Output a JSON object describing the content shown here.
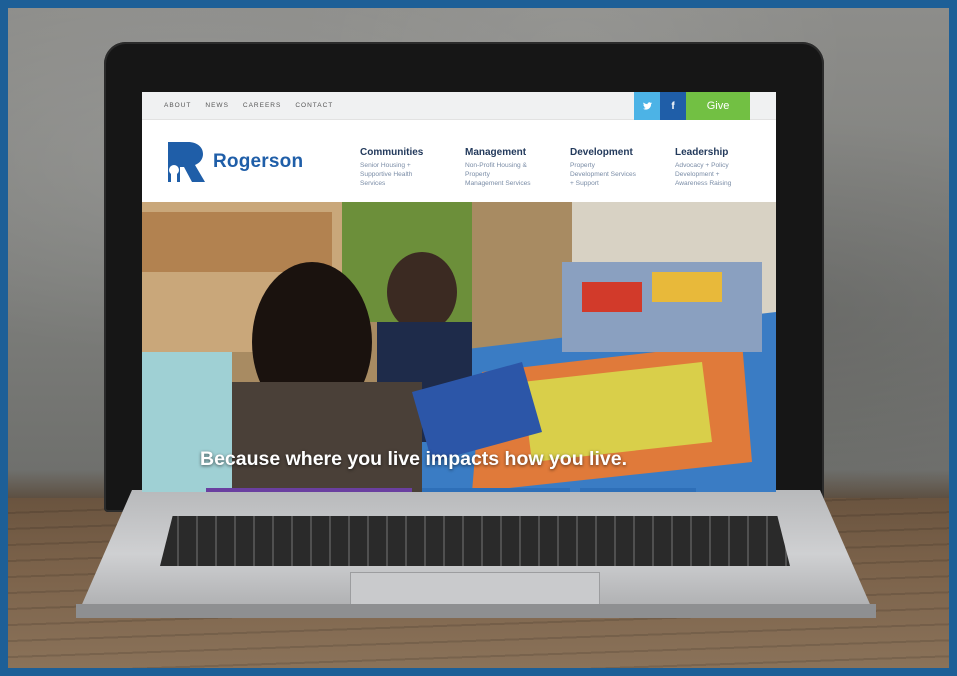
{
  "site": {
    "top_nav": [
      "ABOUT",
      "NEWS",
      "CAREERS",
      "CONTACT"
    ],
    "social": {
      "twitter": "twitter-icon",
      "facebook": "f"
    },
    "give_label": "Give",
    "brand": "Rogerson",
    "nav": [
      {
        "title": "Communities",
        "sub": [
          "Senior Housing +",
          "Supportive Health",
          "Services"
        ]
      },
      {
        "title": "Management",
        "sub": [
          "Non-Profit Housing &",
          "Property",
          "Management Services"
        ]
      },
      {
        "title": "Development",
        "sub": [
          "Property",
          "Development Services",
          "+ Support"
        ]
      },
      {
        "title": "Leadership",
        "sub": [
          "Advocacy + Policy",
          "Development +",
          "Awareness Raising"
        ]
      }
    ],
    "hero_caption": "Because where you live impacts how you live."
  },
  "colors": {
    "brand_blue": "#1f5ea8",
    "give_green": "#72c043",
    "twitter_blue": "#4cb3e6",
    "frame_blue": "#1d5f97"
  }
}
